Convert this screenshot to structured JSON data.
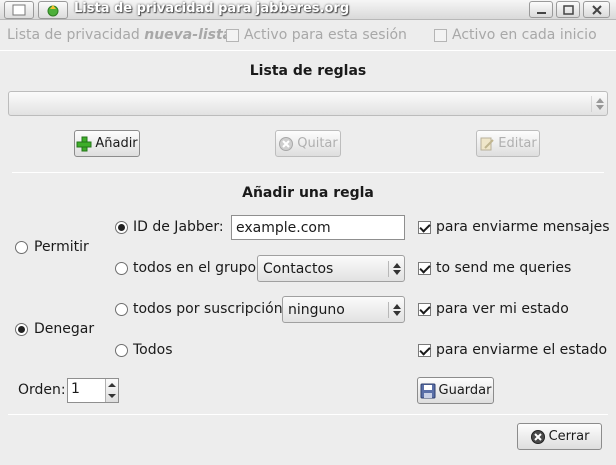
{
  "window": {
    "title": "Lista de privacidad para jabberes.org"
  },
  "header": {
    "list_label": "Lista de privacidad",
    "list_name": "nueva-lista",
    "active_session_label": "Activo para esta sesión",
    "active_startup_label": "Activo en cada inicio"
  },
  "rules": {
    "heading": "Lista de reglas",
    "selected": "",
    "add_label": "Añadir",
    "remove_label": "Quitar",
    "edit_label": "Editar"
  },
  "add_rule": {
    "heading": "Añadir una regla",
    "allow_label": "Permitir",
    "deny_label": "Denegar",
    "action_selected": "Denegar",
    "jid_label": "ID de Jabber:",
    "jid_value": "example.com",
    "group_label": "todos en el grupo",
    "group_value": "Contactos",
    "subscription_label": "todos por suscripción",
    "subscription_value": "ninguno",
    "all_label": "Todos",
    "type_selected": "ID de Jabber:",
    "block_messages": "para enviarme mensajes",
    "block_queries": "to send me queries",
    "block_status_view": "para ver mi estado",
    "block_status_send": "para enviarme el estado",
    "order_label": "Orden:",
    "order_value": "1",
    "save_label": "Guardar"
  },
  "footer": {
    "close_label": "Cerrar"
  },
  "colors": {
    "background": "#ededed",
    "disabled_text": "#a8a8a8"
  }
}
